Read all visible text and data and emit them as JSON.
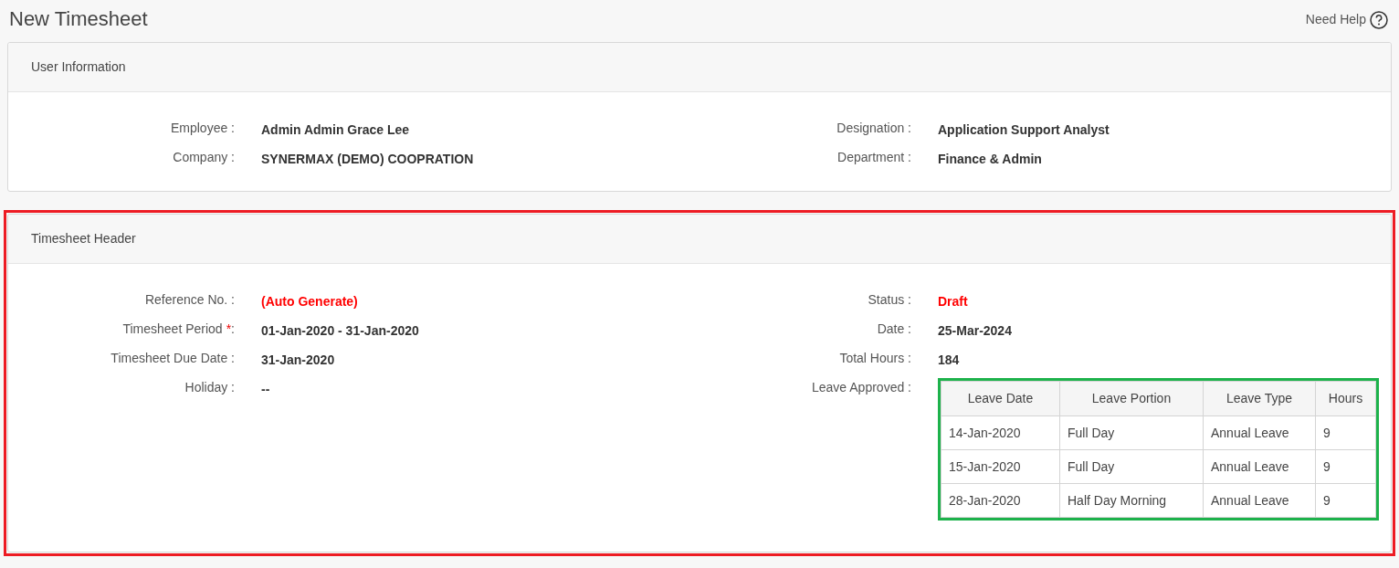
{
  "page": {
    "title": "New Timesheet",
    "help_link": "Need Help"
  },
  "sections": [
    {
      "title": "User Information",
      "outlined": false,
      "columns": [
        [
          {
            "label": "Employee :",
            "value": "Admin Admin Grace Lee",
            "highlight": false
          },
          {
            "label": "Company :",
            "value": "SYNERMAX (DEMO) COOPRATION",
            "highlight": false
          }
        ],
        [
          {
            "label": "Designation :",
            "value": "Application Support Analyst",
            "highlight": false
          },
          {
            "label": "Department :",
            "value": "Finance & Admin",
            "highlight": false
          }
        ]
      ]
    },
    {
      "title": "Timesheet Header",
      "outlined": true,
      "columns": [
        [
          {
            "label": "Reference No. :",
            "value": "(Auto Generate)",
            "highlight": true
          },
          {
            "label": "Timesheet Period",
            "required_mark": "*",
            "label_suffix": ":",
            "value": "01-Jan-2020 - 31-Jan-2020",
            "highlight": false
          },
          {
            "label": "Timesheet Due Date :",
            "value": "31-Jan-2020",
            "highlight": false
          },
          {
            "label": "Holiday :",
            "value": "--",
            "highlight": false
          }
        ],
        [
          {
            "label": "Status :",
            "value": "Draft",
            "highlight": true
          },
          {
            "label": "Date :",
            "value": "25-Mar-2024",
            "highlight": false
          },
          {
            "label": "Total Hours :",
            "value": "184",
            "highlight": false
          },
          {
            "label": "Leave Approved :",
            "table": {
              "outlined": true,
              "columns": [
                "Leave Date",
                "Leave Portion",
                "Leave Type",
                "Hours"
              ],
              "rows": [
                [
                  "14-Jan-2020",
                  "Full Day",
                  "Annual Leave",
                  "9"
                ],
                [
                  "15-Jan-2020",
                  "Full Day",
                  "Annual Leave",
                  "9"
                ],
                [
                  "28-Jan-2020",
                  "Half Day Morning",
                  "Annual Leave",
                  "9"
                ]
              ]
            }
          }
        ]
      ]
    }
  ]
}
